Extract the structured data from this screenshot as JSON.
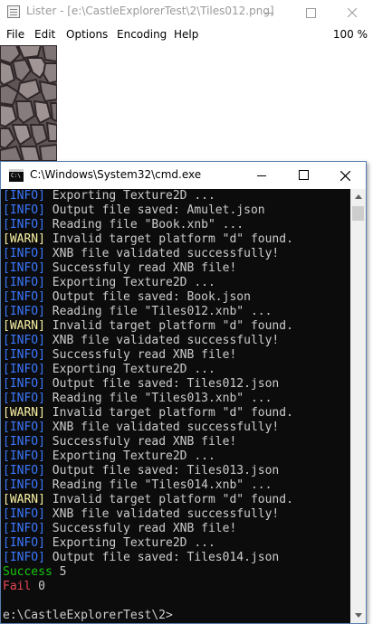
{
  "lister": {
    "title": "Lister - [e:\\CastleExplorerTest\\2\\Tiles012.png]",
    "menu": [
      "File",
      "Edit",
      "Options",
      "Encoding",
      "Help"
    ],
    "zoom": "100 %"
  },
  "cmd": {
    "title": "C:\\Windows\\System32\\cmd.exe",
    "icon_text": "C:\\",
    "lines": [
      {
        "tag": "[INFO]",
        "text": " Exporting Texture2D ..."
      },
      {
        "tag": "[INFO]",
        "text": " Output file saved: Amulet.json"
      },
      {
        "tag": "[INFO]",
        "text": " Reading file \"Book.xnb\" ..."
      },
      {
        "tag": "[WARN]",
        "text": " Invalid target platform \"d\" found."
      },
      {
        "tag": "[INFO]",
        "text": " XNB file validated successfully!"
      },
      {
        "tag": "[INFO]",
        "text": " Successfuly read XNB file!"
      },
      {
        "tag": "[INFO]",
        "text": " Exporting Texture2D ..."
      },
      {
        "tag": "[INFO]",
        "text": " Output file saved: Book.json"
      },
      {
        "tag": "[INFO]",
        "text": " Reading file \"Tiles012.xnb\" ..."
      },
      {
        "tag": "[WARN]",
        "text": " Invalid target platform \"d\" found."
      },
      {
        "tag": "[INFO]",
        "text": " XNB file validated successfully!"
      },
      {
        "tag": "[INFO]",
        "text": " Successfuly read XNB file!"
      },
      {
        "tag": "[INFO]",
        "text": " Exporting Texture2D ..."
      },
      {
        "tag": "[INFO]",
        "text": " Output file saved: Tiles012.json"
      },
      {
        "tag": "[INFO]",
        "text": " Reading file \"Tiles013.xnb\" ..."
      },
      {
        "tag": "[WARN]",
        "text": " Invalid target platform \"d\" found."
      },
      {
        "tag": "[INFO]",
        "text": " XNB file validated successfully!"
      },
      {
        "tag": "[INFO]",
        "text": " Successfuly read XNB file!"
      },
      {
        "tag": "[INFO]",
        "text": " Exporting Texture2D ..."
      },
      {
        "tag": "[INFO]",
        "text": " Output file saved: Tiles013.json"
      },
      {
        "tag": "[INFO]",
        "text": " Reading file \"Tiles014.xnb\" ..."
      },
      {
        "tag": "[WARN]",
        "text": " Invalid target platform \"d\" found."
      },
      {
        "tag": "[INFO]",
        "text": " XNB file validated successfully!"
      },
      {
        "tag": "[INFO]",
        "text": " Successfuly read XNB file!"
      },
      {
        "tag": "[INFO]",
        "text": " Exporting Texture2D ..."
      },
      {
        "tag": "[INFO]",
        "text": " Output file saved: Tiles014.json"
      }
    ],
    "success_label": "Success",
    "success_count": "5",
    "fail_label": "Fail",
    "fail_count": "0",
    "prompt": "e:\\CastleExplorerTest\\2>"
  },
  "colors": {
    "info": "#3b78ff",
    "warn": "#f9f1a5",
    "text": "#cccccc",
    "success": "#16c60c",
    "fail": "#e74856",
    "console_bg": "#0c0c0c"
  }
}
